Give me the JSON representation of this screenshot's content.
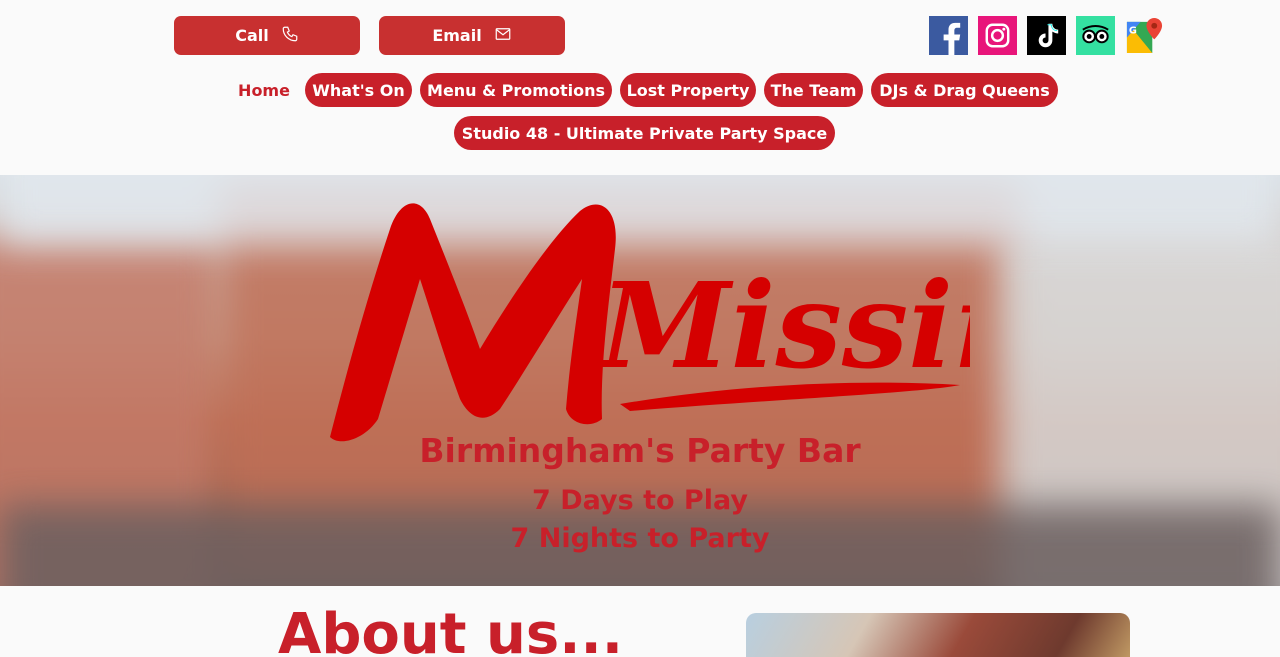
{
  "topbar": {
    "call_label": "Call",
    "email_label": "Email"
  },
  "social": [
    "facebook-icon",
    "instagram-icon",
    "tiktok-icon",
    "tripadvisor-icon",
    "google-maps-icon"
  ],
  "nav": {
    "items": [
      {
        "label": "Home",
        "active": true
      },
      {
        "label": "What's On"
      },
      {
        "label": "Menu & Promotions"
      },
      {
        "label": "Lost Property"
      },
      {
        "label": "The Team"
      },
      {
        "label": "DJs & Drag Queens"
      },
      {
        "label": "Studio 48 - Ultimate Private Party Space"
      }
    ]
  },
  "hero": {
    "logo_text": "Missing",
    "title": "Birmingham's Party Bar",
    "line1": "7 Days to Play",
    "line2": "7 Nights to Party"
  },
  "about": {
    "title": "About us..."
  },
  "colors": {
    "brand_red": "#c8202a",
    "button_red": "#c83030",
    "background": "#fafafa"
  }
}
